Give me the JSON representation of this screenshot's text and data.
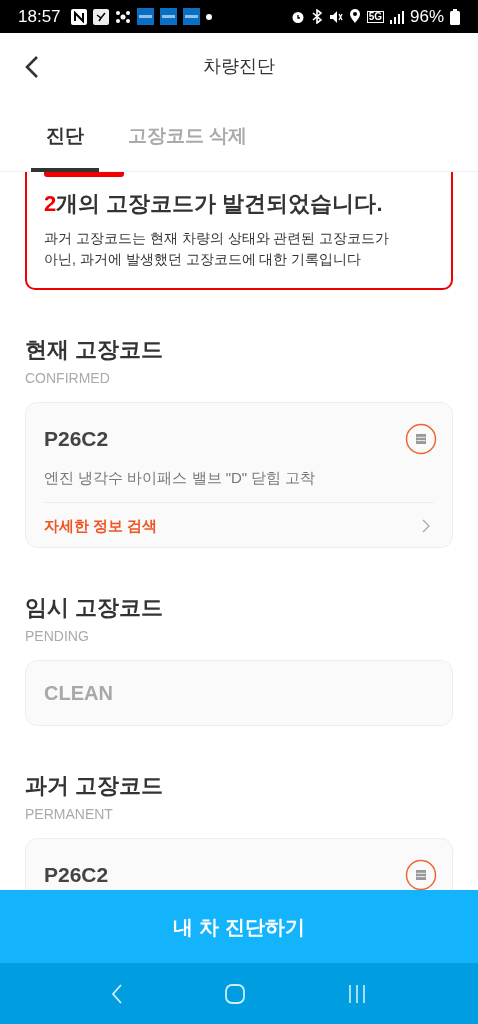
{
  "status_bar": {
    "time": "18:57",
    "network": "5G",
    "battery": "96%"
  },
  "header": {
    "title": "차량진단"
  },
  "tabs": [
    {
      "label": "진단",
      "selected": true
    },
    {
      "label": "고장코드 삭제",
      "selected": false
    }
  ],
  "alert": {
    "count": "2",
    "headline": "개의 고장코드가 발견되었습니다.",
    "note": "과거 고장코드는 현재 차량의 상태와 관련된 고장코드가 아닌, 과거에 발생했던 고장코드에 대한 기록입니다"
  },
  "sections": [
    {
      "title": "현재 고장코드",
      "subtitle": "CONFIRMED",
      "card": {
        "kind": "code",
        "code": "P26C2",
        "description": "엔진 냉각수 바이패스 밸브 \"D\" 닫힘 고착",
        "link": "자세한 정보 검색"
      }
    },
    {
      "title": "임시 고장코드",
      "subtitle": "PENDING",
      "card": {
        "kind": "empty",
        "text": "CLEAN"
      }
    },
    {
      "title": "과거 고장코드",
      "subtitle": "PERMANENT",
      "card": {
        "kind": "code",
        "code": "P26C2"
      }
    }
  ],
  "action_button": "내 차 진단하기"
}
